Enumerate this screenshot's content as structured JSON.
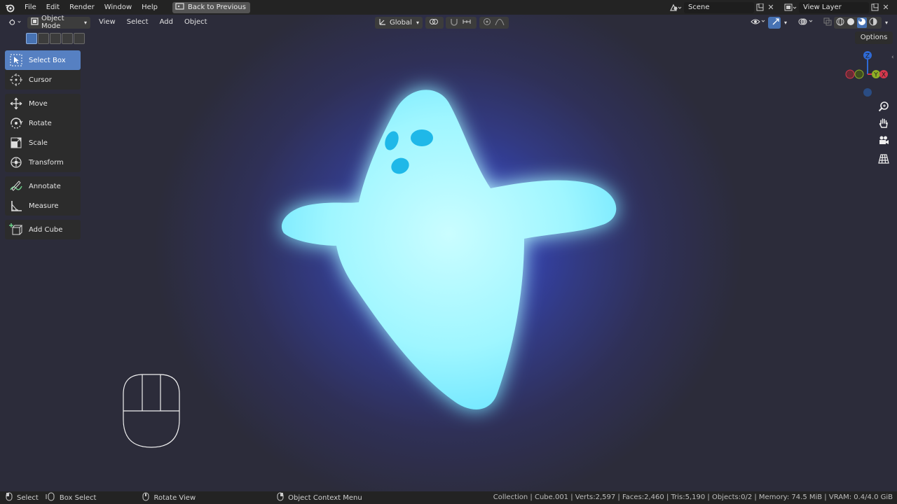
{
  "topbar": {
    "menus": [
      "File",
      "Edit",
      "Render",
      "Window",
      "Help"
    ],
    "back_label": "Back to Previous",
    "scene_name": "Scene",
    "view_layer_name": "View Layer"
  },
  "viewport_header": {
    "mode_label": "Object Mode",
    "menus": [
      "View",
      "Select",
      "Add",
      "Object"
    ],
    "transform_orientation": "Global",
    "options_label": "Options"
  },
  "toolbar": {
    "groups": [
      [
        {
          "label": "Select Box",
          "icon": "select-box-icon",
          "active": true
        },
        {
          "label": "Cursor",
          "icon": "cursor-icon"
        }
      ],
      [
        {
          "label": "Move",
          "icon": "move-icon"
        },
        {
          "label": "Rotate",
          "icon": "rotate-icon"
        },
        {
          "label": "Scale",
          "icon": "scale-icon"
        },
        {
          "label": "Transform",
          "icon": "transform-icon"
        }
      ],
      [
        {
          "label": "Annotate",
          "icon": "annotate-icon"
        },
        {
          "label": "Measure",
          "icon": "measure-icon"
        }
      ],
      [
        {
          "label": "Add Cube",
          "icon": "add-cube-icon"
        }
      ]
    ]
  },
  "gizmo": {
    "z": "Z",
    "y": "Y",
    "x": "X"
  },
  "statusbar": {
    "select": "Select",
    "box_select": "Box Select",
    "rotate_view": "Rotate View",
    "context_menu": "Object Context Menu",
    "stats": "Collection | Cube.001 | Verts:2,597 | Faces:2,460 | Tris:5,190 | Objects:0/2 | Memory: 74.5 MiB | VRAM: 0.4/4.0 GiB"
  },
  "colors": {
    "accent": "#5680c2",
    "ghost": "#9ffcff",
    "glow": "#3a4fd6"
  }
}
